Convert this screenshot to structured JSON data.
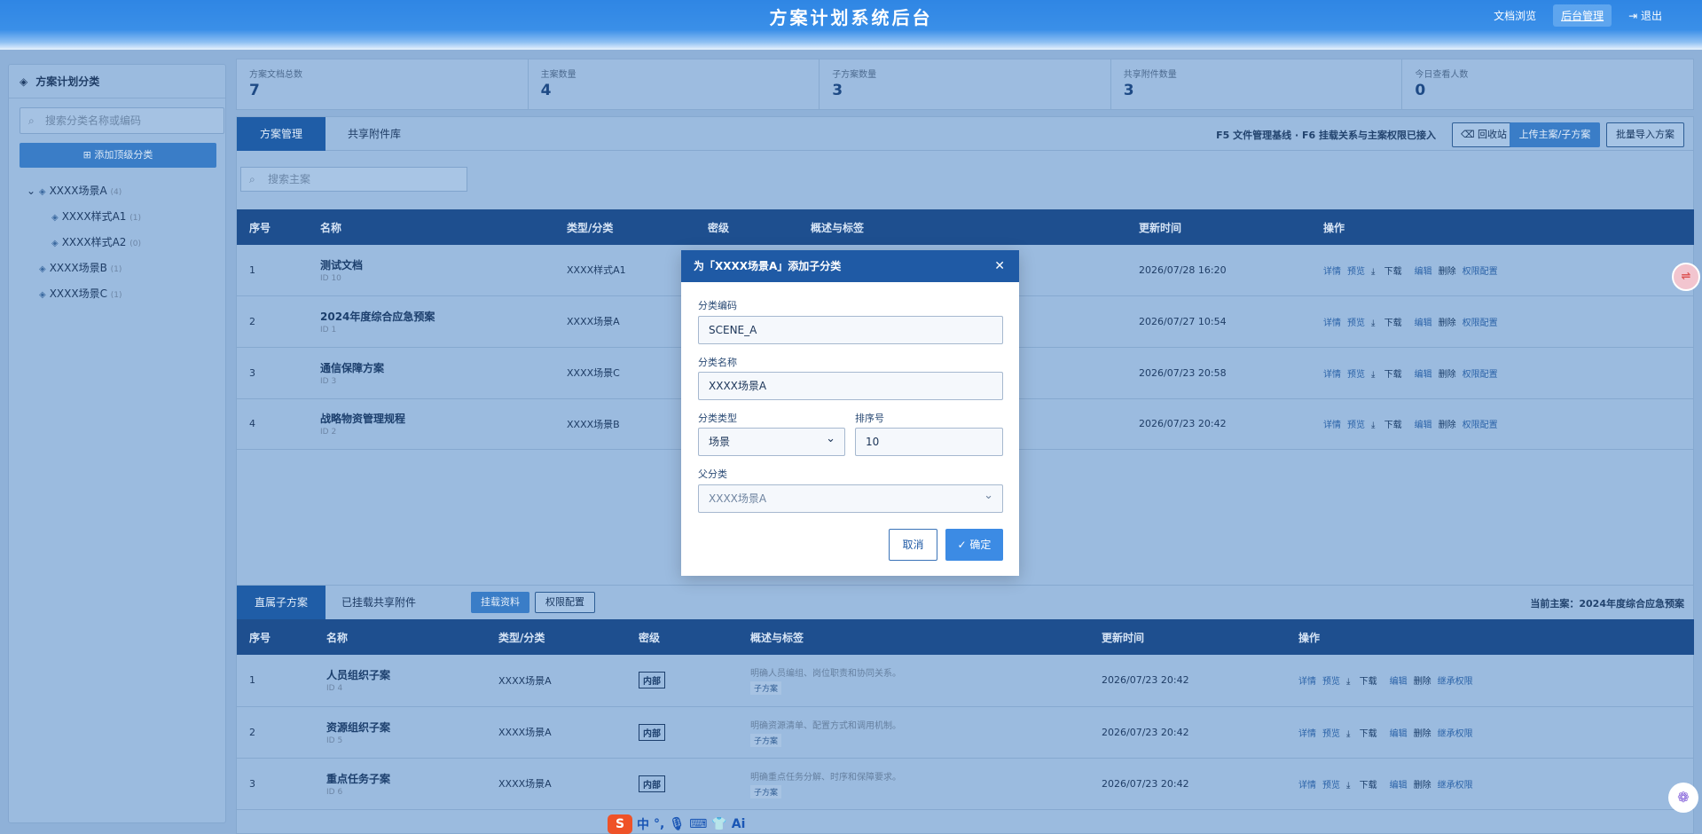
{
  "header": {
    "title": "方案计划系统后台",
    "nav": [
      {
        "label": "文档浏览",
        "active": false
      },
      {
        "label": "后台管理",
        "active": true
      },
      {
        "label": "退出",
        "active": false
      }
    ]
  },
  "sidebar": {
    "title": "方案计划分类",
    "search_placeholder": "搜索分类名称或编码",
    "add_button": "添加顶级分类",
    "tree": [
      {
        "label": "XXXX场景A",
        "count": "(4)",
        "level": 0,
        "expanded": true
      },
      {
        "label": "XXXX样式A1",
        "count": "(1)",
        "level": 1
      },
      {
        "label": "XXXX样式A2",
        "count": "(0)",
        "level": 1
      },
      {
        "label": "XXXX场景B",
        "count": "(1)",
        "level": 0
      },
      {
        "label": "XXXX场景C",
        "count": "(1)",
        "level": 0
      }
    ]
  },
  "stats": [
    {
      "label": "方案文档总数",
      "value": "7"
    },
    {
      "label": "主案数量",
      "value": "4"
    },
    {
      "label": "子方案数量",
      "value": "3"
    },
    {
      "label": "共享附件数量",
      "value": "3"
    },
    {
      "label": "今日查看人数",
      "value": "0"
    }
  ],
  "main": {
    "tabs": [
      "方案管理",
      "共享附件库"
    ],
    "info": "F5 文件管理基线 · F6 挂载关系与主案权限已接入",
    "buttons": {
      "recycle": "回收站",
      "upload": "上传主案/子方案",
      "import": "批量导入方案"
    },
    "search_placeholder": "搜索主案",
    "columns": [
      "序号",
      "名称",
      "类型/分类",
      "密级",
      "概述与标签",
      "更新时间",
      "操作"
    ],
    "rows": [
      {
        "no": "1",
        "name": "测试文档",
        "id": "ID 10",
        "type": "XXXX样式A1",
        "updated": "2026/07/28 16:20"
      },
      {
        "no": "2",
        "name": "2024年度综合应急预案",
        "id": "ID 1",
        "type": "XXXX场景A",
        "updated": "2026/07/27 10:54"
      },
      {
        "no": "3",
        "name": "通信保障方案",
        "id": "ID 3",
        "type": "XXXX场景C",
        "updated": "2026/07/23 20:58"
      },
      {
        "no": "4",
        "name": "战略物资管理规程",
        "id": "ID 2",
        "type": "XXXX场景B",
        "updated": "2026/07/23 20:42"
      }
    ],
    "ops": [
      "详情",
      "预览",
      "下载",
      "编辑",
      "删除",
      "权限配置"
    ]
  },
  "sub": {
    "tabs": [
      "直属子方案",
      "已挂载共享附件"
    ],
    "buttons": {
      "mount": "挂载资料",
      "perm": "权限配置"
    },
    "current": "当前主案：2024年度综合应急预案",
    "columns": [
      "序号",
      "名称",
      "类型/分类",
      "密级",
      "概述与标签",
      "更新时间",
      "操作"
    ],
    "rows": [
      {
        "no": "1",
        "name": "人员组织子案",
        "id": "ID 4",
        "type": "XXXX场景A",
        "secret": "内部",
        "desc": "明确人员编组、岗位职责和协同关系。",
        "tag": "子方案",
        "updated": "2026/07/23 20:42"
      },
      {
        "no": "2",
        "name": "资源组织子案",
        "id": "ID 5",
        "type": "XXXX场景A",
        "secret": "内部",
        "desc": "明确资源清单、配置方式和调用机制。",
        "tag": "子方案",
        "updated": "2026/07/23 20:42"
      },
      {
        "no": "3",
        "name": "重点任务子案",
        "id": "ID 6",
        "type": "XXXX场景A",
        "secret": "内部",
        "desc": "明确重点任务分解、时序和保障要求。",
        "tag": "子方案",
        "updated": "2026/07/23 20:42"
      }
    ],
    "ops": [
      "详情",
      "预览",
      "下载",
      "编辑",
      "删除",
      "继承权限"
    ]
  },
  "modal": {
    "title": "为「XXXX场景A」添加子分类",
    "code_label": "分类编码",
    "code_value": "SCENE_A",
    "name_label": "分类名称",
    "name_value": "XXXX场景A",
    "type_label": "分类类型",
    "type_value": "场景",
    "order_label": "排序号",
    "order_value": "10",
    "parent_label": "父分类",
    "parent_value": "XXXX场景A",
    "cancel": "取消",
    "ok": "确定"
  },
  "ime": {
    "s": "S",
    "lang": "中",
    "ai": "Ai"
  }
}
